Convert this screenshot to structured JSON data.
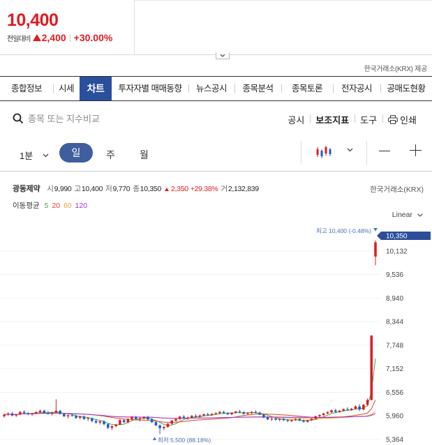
{
  "header": {
    "price": "10,400",
    "change_label": "전일대비",
    "change_value": "2,400",
    "change_percent": "+30.00%",
    "provider": "한국거래소(KRX) 제공"
  },
  "tabs": [
    {
      "label": "종합정보",
      "active": false
    },
    {
      "label": "시세",
      "active": false
    },
    {
      "label": "차트",
      "active": true
    },
    {
      "label": "투자자별 매매동향",
      "active": false
    },
    {
      "label": "뉴스공시",
      "active": false
    },
    {
      "label": "종목분석",
      "active": false
    },
    {
      "label": "종목토론",
      "active": false
    },
    {
      "label": "전자공시",
      "active": false
    },
    {
      "label": "공매도현황",
      "active": false
    }
  ],
  "search": {
    "placeholder": "종목 또는 지수비교"
  },
  "tools": {
    "disclosure": "공시",
    "indicator": "보조지표",
    "tool": "도구",
    "print": "인쇄"
  },
  "periods": {
    "minute": "1분",
    "day": "일",
    "week": "주",
    "month": "월",
    "selected": "일"
  },
  "info": {
    "name": "광동제약",
    "open_label": "시",
    "open": "9,990",
    "high_label": "고",
    "high": "10,400",
    "low_label": "저",
    "low": "9,770",
    "close_label": "종",
    "close": "10,350",
    "change": "2,350",
    "change_pct": "+29.38%",
    "volume_label": "거",
    "volume": "2,132,839",
    "exchange": "한국거래소(KRX)"
  },
  "moving_average": {
    "label": "이동평균",
    "periods": [
      "5",
      "20",
      "60",
      "120"
    ],
    "colors": [
      "#38a83a",
      "#e8402a",
      "#f0a030",
      "#9b36d8"
    ]
  },
  "scale_mode": "Linear",
  "colors": {
    "up": "#e01b22",
    "down": "#1f5cc8",
    "accent": "#2a4f9c",
    "last_price_tag": "#2b4d9a"
  },
  "chart_data": {
    "type": "candlestick",
    "y_ticks": [
      "10,132",
      "9,536",
      "8,940",
      "8,344",
      "7,748",
      "7,152",
      "6,556",
      "5,960",
      "5,364"
    ],
    "ylim": [
      5364,
      10728
    ],
    "last_price": "10,350",
    "high_annotation": "최고 10,400 (-0.48%)",
    "low_annotation": "최저 5,500 (88.18%)",
    "ohlc": [
      [
        5950,
        6010,
        5920,
        5990
      ],
      [
        5990,
        6050,
        5960,
        6020
      ],
      [
        6020,
        6060,
        5950,
        5970
      ],
      [
        5970,
        6010,
        5930,
        5995
      ],
      [
        5995,
        6080,
        5980,
        6060
      ],
      [
        6060,
        6100,
        6010,
        6030
      ],
      [
        6030,
        6060,
        5980,
        6000
      ],
      [
        6000,
        6040,
        5960,
        6025
      ],
      [
        6025,
        6080,
        6000,
        6055
      ],
      [
        6055,
        6120,
        6030,
        6090
      ],
      [
        6090,
        6120,
        6020,
        6040
      ],
      [
        6040,
        6080,
        5990,
        6010
      ],
      [
        6010,
        6060,
        5970,
        6045
      ],
      [
        6045,
        6380,
        6020,
        6090
      ],
      [
        6090,
        6110,
        5990,
        6010
      ],
      [
        6010,
        6030,
        5930,
        5950
      ],
      [
        5950,
        6000,
        5900,
        5975
      ],
      [
        5975,
        6020,
        5940,
        5960
      ],
      [
        5960,
        5990,
        5880,
        5910
      ],
      [
        5910,
        5960,
        5870,
        5940
      ],
      [
        5940,
        5970,
        5860,
        5880
      ],
      [
        5880,
        5930,
        5830,
        5900
      ],
      [
        5900,
        5920,
        5800,
        5830
      ],
      [
        5830,
        5870,
        5760,
        5790
      ],
      [
        5790,
        5840,
        5740,
        5820
      ],
      [
        5820,
        5850,
        5720,
        5750
      ],
      [
        5750,
        5780,
        5620,
        5660
      ],
      [
        5660,
        5720,
        5600,
        5700
      ],
      [
        5700,
        5760,
        5670,
        5740
      ],
      [
        5740,
        5880,
        5720,
        5850
      ],
      [
        5850,
        5880,
        5780,
        5800
      ],
      [
        5800,
        5900,
        5770,
        5880
      ],
      [
        5880,
        5960,
        5850,
        5930
      ],
      [
        5930,
        5960,
        5860,
        5880
      ],
      [
        5880,
        5920,
        5820,
        5900
      ],
      [
        5900,
        5950,
        5870,
        5930
      ],
      [
        5930,
        5960,
        5850,
        5870
      ],
      [
        5870,
        5900,
        5780,
        5800
      ],
      [
        5800,
        5830,
        5700,
        5720
      ],
      [
        5720,
        5740,
        5500,
        5650
      ],
      [
        5650,
        5700,
        5600,
        5680
      ],
      [
        5680,
        5780,
        5660,
        5760
      ],
      [
        5760,
        5860,
        5740,
        5840
      ],
      [
        5840,
        5900,
        5800,
        5880
      ],
      [
        5880,
        5960,
        5860,
        5940
      ],
      [
        5940,
        5980,
        5880,
        5900
      ],
      [
        5900,
        5940,
        5860,
        5920
      ],
      [
        5920,
        5980,
        5900,
        5960
      ],
      [
        5960,
        6000,
        5920,
        5940
      ],
      [
        5940,
        5990,
        5900,
        5970
      ],
      [
        5970,
        6020,
        5950,
        6000
      ],
      [
        6000,
        6040,
        5960,
        5980
      ],
      [
        5980,
        6030,
        5960,
        6010
      ],
      [
        6010,
        6050,
        5980,
        6030
      ],
      [
        6030,
        6080,
        6000,
        6060
      ],
      [
        6060,
        6090,
        6010,
        6030
      ],
      [
        6030,
        6060,
        5980,
        6000
      ],
      [
        6000,
        6050,
        5980,
        6040
      ],
      [
        6040,
        6090,
        6020,
        6070
      ],
      [
        6070,
        6110,
        6030,
        6050
      ],
      [
        6050,
        6080,
        5990,
        6010
      ],
      [
        6010,
        6050,
        5980,
        6030
      ],
      [
        6030,
        6080,
        6010,
        6060
      ],
      [
        6060,
        6100,
        6020,
        6040
      ],
      [
        6040,
        6070,
        5980,
        5990
      ],
      [
        5990,
        6010,
        5900,
        5920
      ],
      [
        5920,
        5950,
        5850,
        5870
      ],
      [
        5870,
        5910,
        5830,
        5890
      ],
      [
        5890,
        5920,
        5840,
        5860
      ],
      [
        5860,
        5900,
        5820,
        5880
      ],
      [
        5880,
        5910,
        5830,
        5850
      ],
      [
        5850,
        5880,
        5800,
        5830
      ],
      [
        5830,
        5870,
        5800,
        5860
      ],
      [
        5860,
        5900,
        5830,
        5880
      ],
      [
        5880,
        5910,
        5820,
        5840
      ],
      [
        5840,
        5870,
        5790,
        5810
      ],
      [
        5810,
        5860,
        5790,
        5850
      ],
      [
        5850,
        5900,
        5830,
        5890
      ],
      [
        5890,
        5960,
        5870,
        5950
      ],
      [
        5950,
        6000,
        5920,
        5980
      ],
      [
        5980,
        6040,
        5960,
        6020
      ],
      [
        6020,
        6080,
        6000,
        6050
      ],
      [
        6050,
        6120,
        6030,
        6100
      ],
      [
        6100,
        6140,
        6040,
        6060
      ],
      [
        6060,
        6110,
        6040,
        6090
      ],
      [
        6090,
        6150,
        6070,
        6130
      ],
      [
        6130,
        6180,
        6090,
        6110
      ],
      [
        6110,
        6160,
        6090,
        6140
      ],
      [
        6140,
        6230,
        6120,
        6200
      ],
      [
        6200,
        6260,
        6080,
        6120
      ],
      [
        6120,
        6260,
        6100,
        6240
      ],
      [
        6240,
        6400,
        6220,
        6360
      ],
      [
        6360,
        8000,
        6360,
        7990
      ],
      [
        9990,
        10400,
        9770,
        10350
      ]
    ]
  }
}
